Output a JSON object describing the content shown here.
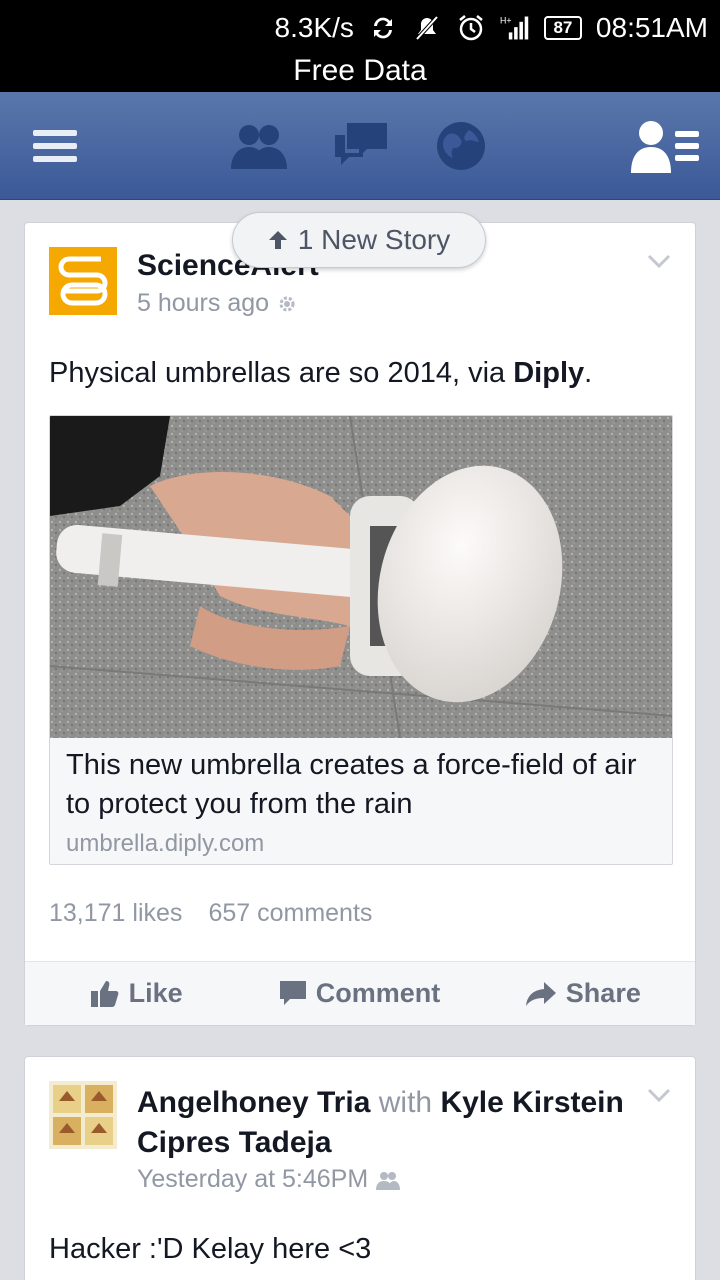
{
  "status_bar": {
    "speed": "8.3K/s",
    "battery": "87",
    "time": "08:51AM",
    "carrier_banner": "Free Data",
    "icons": [
      "sync-icon",
      "muted-icon",
      "alarm-icon",
      "signal-icon",
      "battery-icon"
    ]
  },
  "top_bar": {
    "items": [
      "menu-icon",
      "friend-requests-icon",
      "messages-icon",
      "notifications-globe-icon",
      "friends-list-icon"
    ],
    "brand_color": "#3b5998"
  },
  "new_story": {
    "label": "1 New Story"
  },
  "feed": {
    "post1": {
      "author": "ScienceAlert",
      "time": "5 hours ago",
      "text_prefix": "Physical umbrellas are so 2014, via ",
      "text_link": "Diply",
      "text_suffix": ".",
      "share_title": "This new umbrella creates a force-field of  air to protect you from the rain",
      "share_domain": "umbrella.diply.com",
      "likes": "13,171 likes",
      "comments": "657 comments",
      "actions": {
        "like": "Like",
        "comment": "Comment",
        "share": "Share"
      }
    },
    "post2": {
      "author": "Angelhoney Tria",
      "with_word": "with",
      "tagged": "Kyle Kirstein Cipres Tadeja",
      "time": "Yesterday at 5:46PM",
      "text": "Hacker :'D Kelay here <3"
    }
  }
}
